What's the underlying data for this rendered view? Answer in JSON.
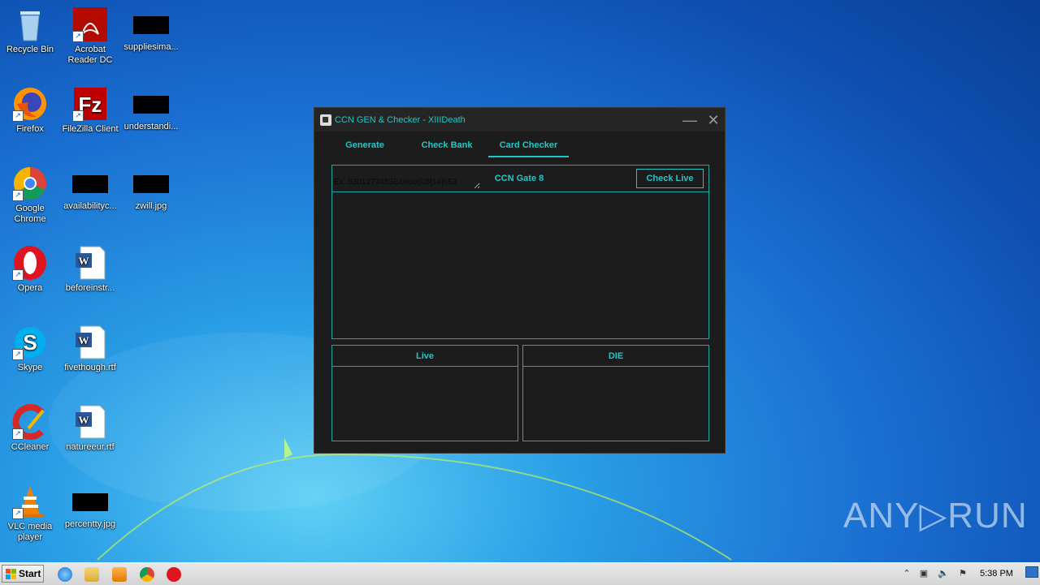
{
  "desktop": {
    "icons": [
      {
        "label": "Recycle Bin"
      },
      {
        "label": "Acrobat Reader DC"
      },
      {
        "label": "suppliesima..."
      },
      {
        "label": "Firefox"
      },
      {
        "label": "FileZilla Client"
      },
      {
        "label": "understandi..."
      },
      {
        "label": "Google Chrome"
      },
      {
        "label": "availabilityc..."
      },
      {
        "label": "zwill.jpg"
      },
      {
        "label": "Opera"
      },
      {
        "label": "beforeinstr..."
      },
      {
        "label": "Skype"
      },
      {
        "label": "fivethough.rtf"
      },
      {
        "label": "CCleaner"
      },
      {
        "label": "natureeur.rtf"
      },
      {
        "label": "VLC media player"
      },
      {
        "label": "percentty.jpg"
      }
    ]
  },
  "window": {
    "title": "CCN GEN & Checker - XIIIDeath",
    "tabs": [
      {
        "label": "Generate"
      },
      {
        "label": "Check Bank"
      },
      {
        "label": "Card Checker",
        "active": true
      }
    ],
    "gate_title": "CCN Gate 8",
    "check_live_label": "Check Live",
    "card_input_placeholder": "Ex: 5301272453Exxxxx|05|14|653",
    "live_title": "Live",
    "die_title": "DIE"
  },
  "taskbar": {
    "start_label": "Start",
    "clock": "5:38 PM"
  },
  "watermark": "ANY▷RUN",
  "colors": {
    "accent": "#21c7c7",
    "window_bg": "#1c1c1c"
  }
}
